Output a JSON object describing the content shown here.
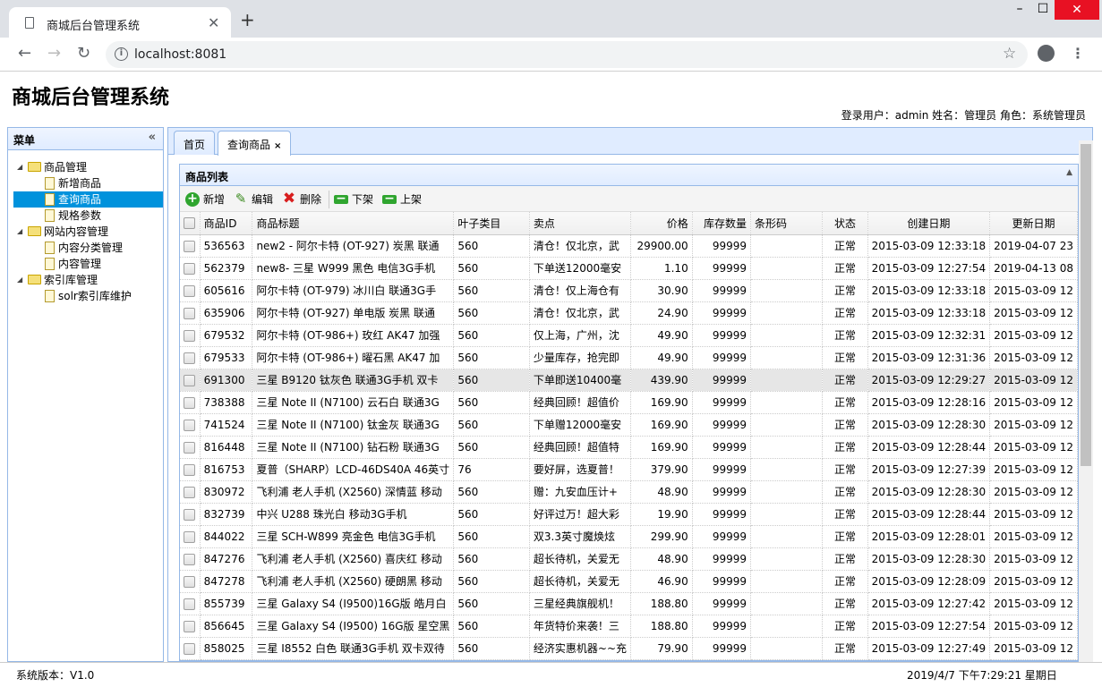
{
  "browser": {
    "tab_title": "商城后台管理系统",
    "tab_close": "✕",
    "new_tab": "+",
    "url": "localhost:8081",
    "win_min": "–",
    "win_max": "☐",
    "win_close": "✕"
  },
  "app": {
    "title": "商城后台管理系统",
    "user_info": "登录用户：admin  姓名：管理员  角色：系统管理员"
  },
  "sidebar": {
    "title": "菜单",
    "collapse": "«",
    "tree": [
      {
        "label": "商品管理",
        "children": [
          "新增商品",
          "查询商品",
          "规格参数"
        ]
      },
      {
        "label": "网站内容管理",
        "children": [
          "内容分类管理",
          "内容管理"
        ]
      },
      {
        "label": "索引库管理",
        "children": [
          "solr索引库维护"
        ]
      }
    ],
    "selected": "查询商品"
  },
  "tabs": [
    {
      "label": "首页"
    },
    {
      "label": "查询商品",
      "closable": "×"
    }
  ],
  "panel": {
    "title": "商品列表",
    "collapse": "▲"
  },
  "toolbar": {
    "add": "新增",
    "edit": "编辑",
    "delete": "删除",
    "offshelf": "下架",
    "onshelf": "上架"
  },
  "grid": {
    "columns": [
      "商品ID",
      "商品标题",
      "叶子类目",
      "卖点",
      "价格",
      "库存数量",
      "条形码",
      "状态",
      "创建日期",
      "更新日期"
    ],
    "rows": [
      [
        "536563",
        "new2 - 阿尔卡特 (OT-927) 炭黑 联通",
        "560",
        "清仓！仅北京，武",
        "29900.00",
        "99999",
        "",
        "正常",
        "2015-03-09 12:33:18",
        "2019-04-07 23"
      ],
      [
        "562379",
        "new8- 三星 W999 黑色 电信3G手机 ",
        "560",
        "下单送12000毫安",
        "1.10",
        "99999",
        "",
        "正常",
        "2015-03-09 12:27:54",
        "2019-04-13 08"
      ],
      [
        "605616",
        "阿尔卡特 (OT-979) 冰川白 联通3G手",
        "560",
        "清仓！仅上海仓有",
        "30.90",
        "99999",
        "",
        "正常",
        "2015-03-09 12:33:18",
        "2015-03-09 12"
      ],
      [
        "635906",
        "阿尔卡特 (OT-927) 单电版 炭黑 联通",
        "560",
        "清仓！仅北京，武",
        "24.90",
        "99999",
        "",
        "正常",
        "2015-03-09 12:33:18",
        "2015-03-09 12"
      ],
      [
        "679532",
        "阿尔卡特 (OT-986+) 玫红 AK47 加强",
        "560",
        "仅上海，广州，沈",
        "49.90",
        "99999",
        "",
        "正常",
        "2015-03-09 12:32:31",
        "2015-03-09 12"
      ],
      [
        "679533",
        "阿尔卡特 (OT-986+) 曜石黑 AK47 加",
        "560",
        "少量库存，抢完即",
        "49.90",
        "99999",
        "",
        "正常",
        "2015-03-09 12:31:36",
        "2015-03-09 12"
      ],
      [
        "691300",
        "三星 B9120 钛灰色 联通3G手机 双卡",
        "560",
        "下单即送10400毫",
        "439.90",
        "99999",
        "",
        "正常",
        "2015-03-09 12:29:27",
        "2015-03-09 12"
      ],
      [
        "738388",
        "三星 Note II (N7100) 云石白 联通3G",
        "560",
        "经典回顾！超值价",
        "169.90",
        "99999",
        "",
        "正常",
        "2015-03-09 12:28:16",
        "2015-03-09 12"
      ],
      [
        "741524",
        "三星 Note II (N7100) 钛金灰 联通3G",
        "560",
        "下单赠12000毫安",
        "169.90",
        "99999",
        "",
        "正常",
        "2015-03-09 12:28:30",
        "2015-03-09 12"
      ],
      [
        "816448",
        "三星 Note II (N7100) 钻石粉 联通3G",
        "560",
        "经典回顾！超值特",
        "169.90",
        "99999",
        "",
        "正常",
        "2015-03-09 12:28:44",
        "2015-03-09 12"
      ],
      [
        "816753",
        "夏普（SHARP）LCD-46DS40A 46英寸",
        "76",
        "要好屏，选夏普！",
        "379.90",
        "99999",
        "",
        "正常",
        "2015-03-09 12:27:39",
        "2015-03-09 12"
      ],
      [
        "830972",
        "飞利浦 老人手机 (X2560) 深情蓝 移动",
        "560",
        "赠：九安血压计+",
        "48.90",
        "99999",
        "",
        "正常",
        "2015-03-09 12:28:30",
        "2015-03-09 12"
      ],
      [
        "832739",
        "中兴 U288 珠光白 移动3G手机",
        "560",
        "好评过万！超大彩",
        "19.90",
        "99999",
        "",
        "正常",
        "2015-03-09 12:28:44",
        "2015-03-09 12"
      ],
      [
        "844022",
        "三星 SCH-W899 亮金色 电信3G手机",
        "560",
        "双3.3英寸魔焕炫",
        "299.90",
        "99999",
        "",
        "正常",
        "2015-03-09 12:28:01",
        "2015-03-09 12"
      ],
      [
        "847276",
        "飞利浦 老人手机 (X2560) 喜庆红 移动",
        "560",
        "超长待机，关爱无",
        "48.90",
        "99999",
        "",
        "正常",
        "2015-03-09 12:28:30",
        "2015-03-09 12"
      ],
      [
        "847278",
        "飞利浦 老人手机 (X2560) 硬朗黑 移动",
        "560",
        "超长待机，关爱无",
        "46.90",
        "99999",
        "",
        "正常",
        "2015-03-09 12:28:09",
        "2015-03-09 12"
      ],
      [
        "855739",
        "三星 Galaxy S4 (I9500)16G版 皓月白",
        "560",
        "三星经典旗舰机！",
        "188.80",
        "99999",
        "",
        "正常",
        "2015-03-09 12:27:42",
        "2015-03-09 12"
      ],
      [
        "856645",
        "三星 Galaxy S4 (I9500) 16G版 星空黑",
        "560",
        "年货特价来袭！三",
        "188.80",
        "99999",
        "",
        "正常",
        "2015-03-09 12:27:54",
        "2015-03-09 12"
      ],
      [
        "858025",
        "三星 I8552 白色 联通3G手机 双卡双待",
        "560",
        "经济实惠机器~~充",
        "79.90",
        "99999",
        "",
        "正常",
        "2015-03-09 12:27:49",
        "2015-03-09 12"
      ]
    ],
    "highlighted_row": 6
  },
  "footer": {
    "version": "系统版本：V1.0",
    "clock": "2019/4/7 下午7:29:21 星期日"
  },
  "colors": {
    "accent": "#0092dc",
    "panel_border": "#95b8e7",
    "close_red": "#e81123"
  }
}
